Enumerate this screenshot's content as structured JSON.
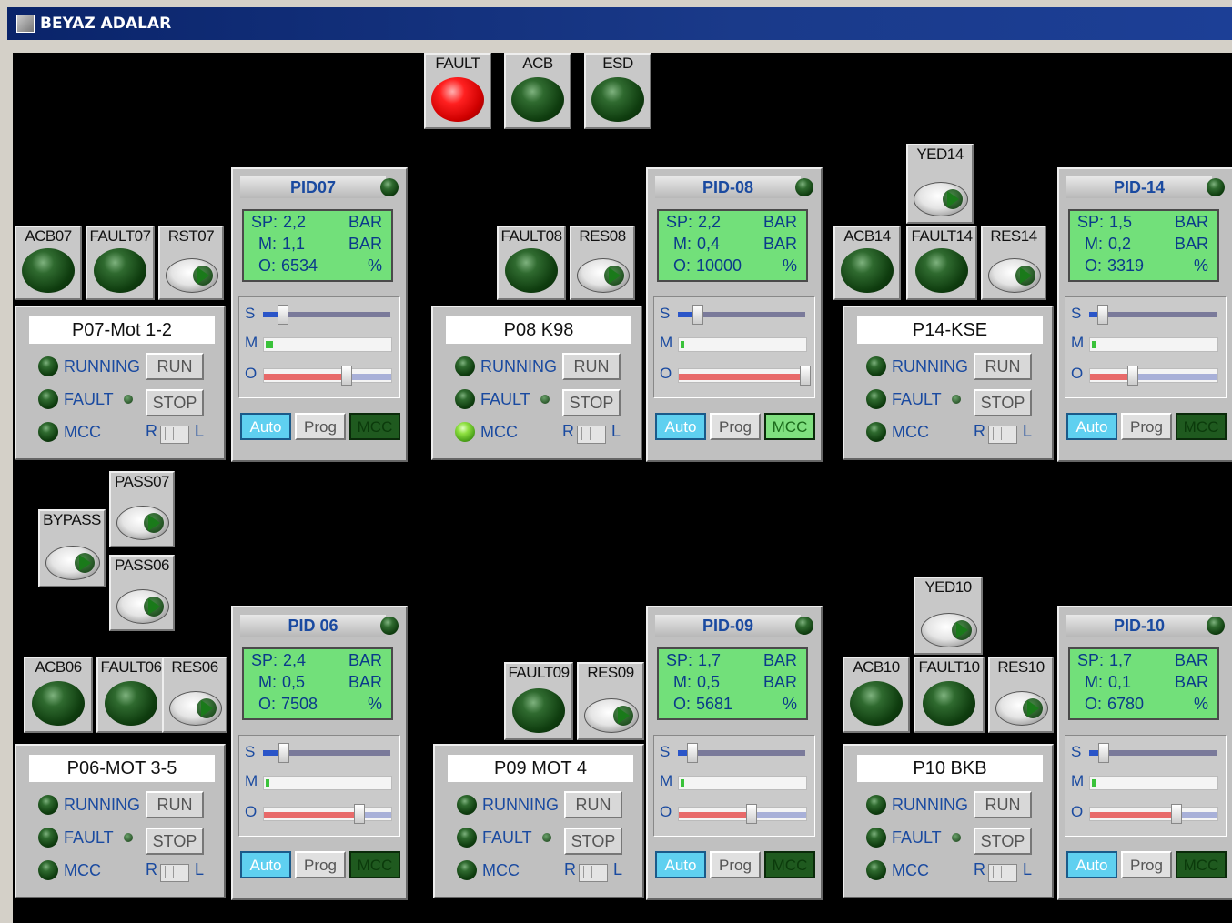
{
  "window": {
    "title": "BEYAZ ADALAR"
  },
  "colors": {
    "lcd": "#72e07a",
    "title_text": "#1a4aa0",
    "fault_on": "#ff2020",
    "auto_btn": "#5fd0f0"
  },
  "top": {
    "fault": "FAULT",
    "acb": "ACB",
    "esd": "ESD"
  },
  "bypass": {
    "bypass": "BYPASS",
    "pass07": "PASS07",
    "pass06": "PASS06"
  },
  "units": {
    "bar": "BAR",
    "pct": "%",
    "sp": "SP:",
    "m": "M:",
    "o": "O:",
    "s_lbl": "S",
    "m_lbl": "M",
    "o_lbl": "O"
  },
  "groups": [
    {
      "id": "g07",
      "tiles": [
        "ACB07",
        "FAULT07",
        "RST07"
      ],
      "yed": "",
      "motor": "P07-Mot 1-2",
      "pid": {
        "title": "PID07",
        "sp": "2,2",
        "m": "1,1",
        "o": "6534",
        "s_frac": 0.15,
        "m_frac": 0.06,
        "o_frac": 0.65,
        "mcc_lit": false
      }
    },
    {
      "id": "g08",
      "tiles": [
        "FAULT08",
        "RES08"
      ],
      "yed": "",
      "motor": "P08 K98",
      "pid": {
        "title": "PID-08",
        "sp": "2,2",
        "m": "0,4",
        "o": "10000",
        "s_frac": 0.15,
        "m_frac": 0.02,
        "o_frac": 1.0,
        "mcc_lit": true
      }
    },
    {
      "id": "g14",
      "tiles": [
        "ACB14",
        "FAULT14",
        "RES14"
      ],
      "yed": "YED14",
      "motor": "P14-KSE",
      "pid": {
        "title": "PID-14",
        "sp": "1,5",
        "m": "0,2",
        "o": "3319",
        "s_frac": 0.1,
        "m_frac": 0.01,
        "o_frac": 0.33,
        "mcc_lit": false
      }
    },
    {
      "id": "g06",
      "tiles": [
        "ACB06",
        "FAULT06",
        "RES06"
      ],
      "yed": "",
      "motor": "P06-MOT 3-5",
      "pid": {
        "title": "PID 06",
        "sp": "2,4",
        "m": "0,5",
        "o": "7508",
        "s_frac": 0.16,
        "m_frac": 0.03,
        "o_frac": 0.75,
        "mcc_lit": false
      }
    },
    {
      "id": "g09",
      "tiles": [
        "FAULT09",
        "RES09"
      ],
      "yed": "",
      "motor": "P09 MOT 4",
      "pid": {
        "title": "PID-09",
        "sp": "1,7",
        "m": "0,5",
        "o": "5681",
        "s_frac": 0.11,
        "m_frac": 0.03,
        "o_frac": 0.57,
        "mcc_lit": false
      }
    },
    {
      "id": "g10",
      "tiles": [
        "ACB10",
        "FAULT10",
        "RES10"
      ],
      "yed": "YED10",
      "motor": "P10 BKB",
      "pid": {
        "title": "PID-10",
        "sp": "1,7",
        "m": "0,1",
        "o": "6780",
        "s_frac": 0.11,
        "m_frac": 0.01,
        "o_frac": 0.68,
        "mcc_lit": false
      }
    }
  ],
  "motor_labels": {
    "running": "RUNNING",
    "fault": "FAULT",
    "mcc": "MCC",
    "run_btn": "RUN",
    "stop_btn": "STOP",
    "r": "R",
    "l": "L"
  },
  "mode_labels": {
    "auto": "Auto",
    "prog": "Prog",
    "mcc": "MCC"
  }
}
